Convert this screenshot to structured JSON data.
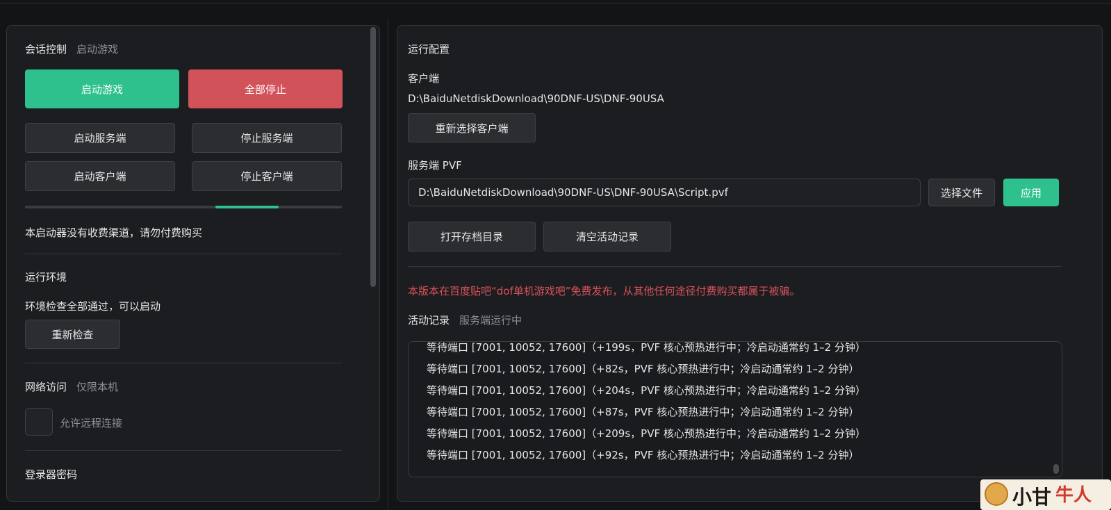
{
  "left": {
    "session": {
      "title": "会话控制",
      "status": "启动游戏"
    },
    "buttons": {
      "start_game": "启动游戏",
      "stop_all": "全部停止",
      "start_server": "启动服务端",
      "stop_server": "停止服务端",
      "start_client": "启动客户端",
      "stop_client": "停止客户端"
    },
    "notice": "本启动器没有收费渠道，请勿付费购买",
    "env": {
      "title": "运行环境",
      "status": "环境检查全部通过，可以启动",
      "recheck": "重新检查"
    },
    "network": {
      "title": "网络访问",
      "status": "仅限本机",
      "allow_remote": "允许远程连接"
    },
    "password_title": "登录器密码"
  },
  "right": {
    "title": "运行配置",
    "client": {
      "label": "客户端",
      "path": "D:\\BaiduNetdiskDownload\\90DNF-US\\DNF-90USA",
      "reselect": "重新选择客户端"
    },
    "server_pvf": {
      "label": "服务端 PVF",
      "path": "D:\\BaiduNetdiskDownload\\90DNF-US\\DNF-90USA\\Script.pvf",
      "choose_file": "选择文件",
      "apply": "应用"
    },
    "open_save_dir": "打开存档目录",
    "clear_activity": "清空活动记录",
    "warning": "本版本在百度贴吧“dof单机游戏吧”免费发布，从其他任何途径付费购买都属于被骗。",
    "activity": {
      "title": "活动记录",
      "status": "服务端运行中",
      "lines": [
        "等待端口 [7001, 10052, 17600]（+199s，PVF 核心预热进行中；冷启动通常约 1–2 分钟）",
        "等待端口 [7001, 10052, 17600]（+82s，PVF 核心预热进行中；冷启动通常约 1–2 分钟）",
        "等待端口 [7001, 10052, 17600]（+204s，PVF 核心预热进行中；冷启动通常约 1–2 分钟）",
        "等待端口 [7001, 10052, 17600]（+87s，PVF 核心预热进行中；冷启动通常约 1–2 分钟）",
        "等待端口 [7001, 10052, 17600]（+209s，PVF 核心预热进行中；冷启动通常约 1–2 分钟）",
        "等待端口 [7001, 10052, 17600]（+92s，PVF 核心预热进行中；冷启动通常约 1–2 分钟）"
      ]
    }
  },
  "progress": {
    "fill_start": 0.6,
    "fill_fraction": 0.2
  },
  "watermark": {
    "brand_text_1": "小甘",
    "brand_text_2": "牛人"
  },
  "colors": {
    "accent_green": "#2ec08d",
    "danger_red": "#d2525a",
    "warning_text": "#d9525a"
  }
}
